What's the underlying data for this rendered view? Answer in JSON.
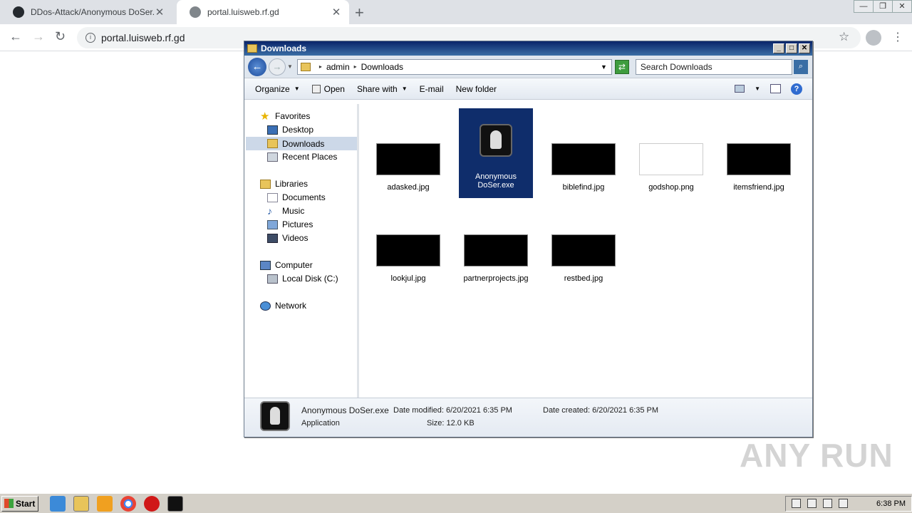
{
  "browser": {
    "tabs": [
      {
        "title": "DDos-Attack/Anonymous DoSer.exe",
        "close": "✕"
      },
      {
        "title": "portal.luisweb.rf.gd",
        "close": "✕"
      }
    ],
    "new_tab": "+",
    "window_controls": [
      "—",
      "❐",
      "✕"
    ],
    "url": "portal.luisweb.rf.gd"
  },
  "explorer": {
    "title": "Downloads",
    "title_buttons": [
      "_",
      "□",
      "✕"
    ],
    "address": {
      "segments": [
        "admin",
        "Downloads"
      ]
    },
    "search_placeholder": "Search Downloads",
    "commands": {
      "organize": "Organize",
      "open": "Open",
      "share_with": "Share with",
      "email": "E-mail",
      "new_folder": "New folder"
    },
    "nav": {
      "favorites": "Favorites",
      "desktop": "Desktop",
      "downloads": "Downloads",
      "recent_places": "Recent Places",
      "libraries": "Libraries",
      "documents": "Documents",
      "music": "Music",
      "pictures": "Pictures",
      "videos": "Videos",
      "computer": "Computer",
      "local_disk": "Local Disk (C:)",
      "network": "Network"
    },
    "files": [
      {
        "name": "adasked.jpg"
      },
      {
        "name": "Anonymous DoSer.exe",
        "selected": true
      },
      {
        "name": "biblefind.jpg"
      },
      {
        "name": "godshop.png"
      },
      {
        "name": "itemsfriend.jpg"
      },
      {
        "name": "lookjul.jpg"
      },
      {
        "name": "partnerprojects.jpg"
      },
      {
        "name": "restbed.jpg"
      }
    ],
    "details": {
      "name": "Anonymous DoSer.exe",
      "type": "Application",
      "date_modified": "Date modified: 6/20/2021 6:35 PM",
      "date_created": "Date created: 6/20/2021 6:35 PM",
      "size": "Size: 12.0 KB"
    }
  },
  "watermark": "ANY RUN",
  "taskbar": {
    "start": "Start",
    "clock": "6:38 PM"
  },
  "colors": {
    "selection": "#0f2d6b",
    "titlebar": "#0a246a",
    "taskbar": "#d4d0c8"
  }
}
